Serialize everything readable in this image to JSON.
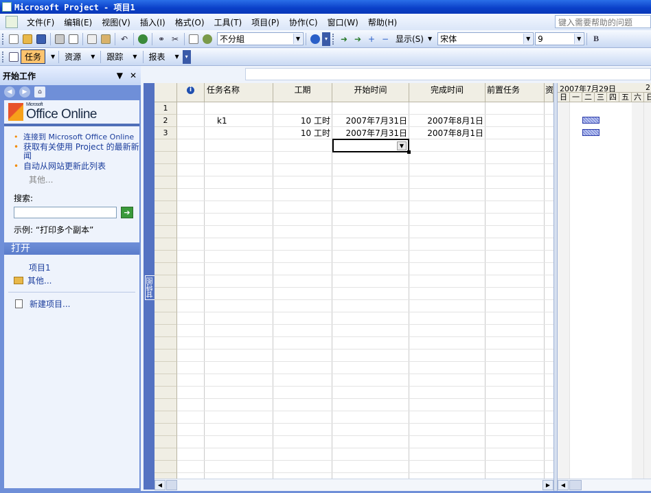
{
  "title": "Microsoft Project - 项目1",
  "menu": {
    "items": [
      "文件(F)",
      "编辑(E)",
      "视图(V)",
      "插入(I)",
      "格式(O)",
      "工具(T)",
      "项目(P)",
      "协作(C)",
      "窗口(W)",
      "帮助(H)"
    ],
    "help_placeholder": "键入需要帮助的问题"
  },
  "toolbar": {
    "group_value": "不分組",
    "show_label": "显示(S)",
    "font_value": "宋体",
    "size_value": "9",
    "bold_label": "B"
  },
  "toolbar2": {
    "task_label": "任务",
    "resource_label": "资源",
    "track_label": "跟踪",
    "report_label": "报表"
  },
  "taskpane": {
    "title": "开始工作",
    "office_small": "Microsoft",
    "office_brand": "Office Online",
    "links": [
      "连接到 Microsoft Office Online",
      "获取有关使用 Project 的最新新闻",
      "自动从网站更新此列表"
    ],
    "more": "其他...",
    "search_label": "搜索:",
    "example": "示例:  “打印多个副本”",
    "open_header": "打开",
    "recent": [
      "项目1"
    ],
    "open_more": "其他...",
    "new_project": "新建项目..."
  },
  "view_bar_label": "甘特图",
  "table": {
    "columns": [
      "",
      "任务名称",
      "工期",
      "开始时间",
      "完成时间",
      "前置任务",
      "资"
    ],
    "rows": [
      {
        "num": "1",
        "name": "",
        "duration": "",
        "start": "",
        "finish": ""
      },
      {
        "num": "2",
        "name": "k1",
        "duration": "10 工时",
        "start": "2007年7月31日",
        "finish": "2007年8月1日"
      },
      {
        "num": "3",
        "name": "",
        "duration": "10 工时",
        "start": "2007年7月31日",
        "finish": "2007年8月1日"
      }
    ]
  },
  "chart": {
    "week_label": "2007年7月29日",
    "next_week_label": "2",
    "days": [
      "日",
      "一",
      "二",
      "三",
      "四",
      "五",
      "六",
      "日"
    ]
  }
}
